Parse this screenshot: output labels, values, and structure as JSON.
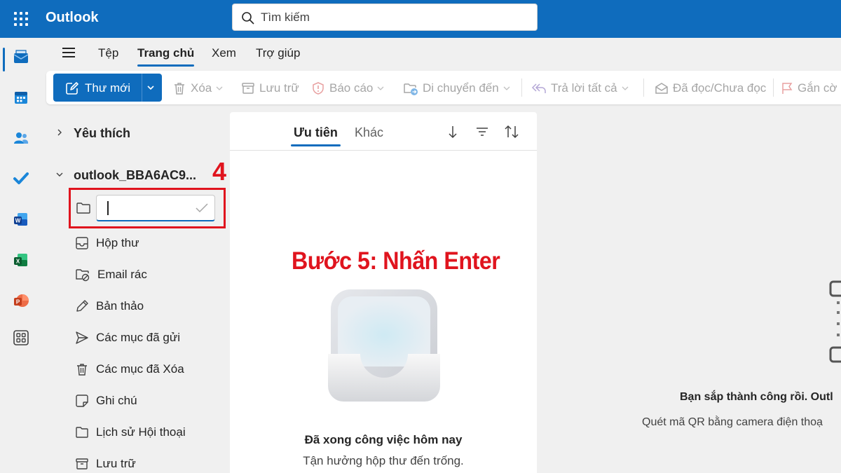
{
  "app": {
    "title": "Outlook"
  },
  "search": {
    "placeholder": "Tìm kiếm"
  },
  "rail": {
    "items": [
      {
        "name": "mail",
        "icon": "mail-icon",
        "active": true
      },
      {
        "name": "calendar",
        "icon": "calendar-icon"
      },
      {
        "name": "people",
        "icon": "people-icon"
      },
      {
        "name": "todo",
        "icon": "todo-check-icon"
      },
      {
        "name": "word",
        "icon": "word-icon"
      },
      {
        "name": "excel",
        "icon": "excel-icon"
      },
      {
        "name": "powerpoint",
        "icon": "powerpoint-icon"
      },
      {
        "name": "apps",
        "icon": "apps-icon"
      }
    ]
  },
  "menu": {
    "tabs": [
      "Tệp",
      "Trang chủ",
      "Xem",
      "Trợ giúp"
    ],
    "active_tab": "Trang chủ"
  },
  "toolbar": {
    "new_mail": "Thư mới",
    "delete": "Xóa",
    "archive": "Lưu trữ",
    "report": "Báo cáo",
    "move_to": "Di chuyển đến",
    "reply_all": "Trả lời tất cả",
    "read_unread": "Đã đọc/Chưa đọc",
    "flag": "Gắn cờ"
  },
  "folders": {
    "favorites": "Yêu thích",
    "account": "outlook_BBA6AC9...",
    "new_folder_value": "",
    "items": [
      {
        "label": "Hộp thư",
        "icon": "inbox-icon"
      },
      {
        "label": "Email rác",
        "icon": "junk-icon"
      },
      {
        "label": "Bản thảo",
        "icon": "drafts-icon"
      },
      {
        "label": "Các mục đã gửi",
        "icon": "sent-icon"
      },
      {
        "label": "Các mục đã Xóa",
        "icon": "trash-icon"
      },
      {
        "label": "Ghi chú",
        "icon": "notes-icon"
      },
      {
        "label": "Lịch sử Hội thoại",
        "icon": "folder-icon"
      },
      {
        "label": "Lưu trữ",
        "icon": "archive-icon"
      }
    ]
  },
  "annotations": {
    "step_number": "4",
    "step_text": "Bước 5: Nhấn Enter",
    "highlight_color": "#e0141e"
  },
  "message_list": {
    "tabs": [
      "Ưu tiên",
      "Khác"
    ],
    "active_tab": "Ưu tiên",
    "empty_title": "Đã xong công việc hôm nay",
    "empty_subtitle": "Tận hưởng hộp thư đến trống."
  },
  "reading_pane": {
    "title": "Bạn sắp thành công rồi. Outl",
    "subtitle": "Quét mã QR bằng camera điện thoạ"
  },
  "colors": {
    "brand": "#0f6cbd",
    "background": "#f0f0f0"
  }
}
